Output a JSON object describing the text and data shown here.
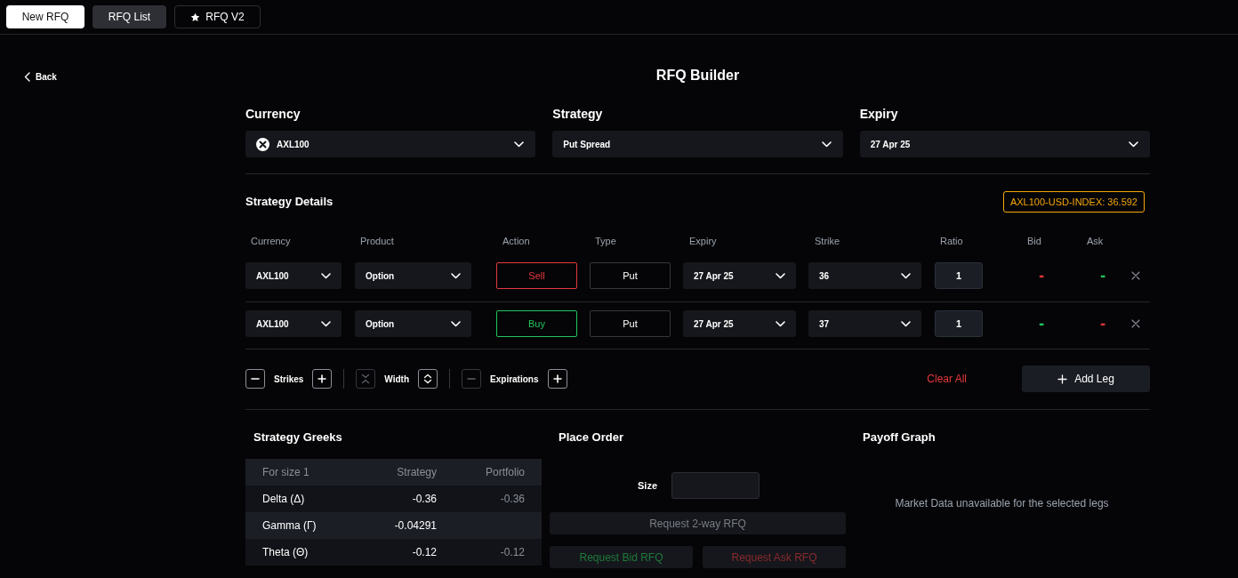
{
  "tabs": [
    {
      "label": "New RFQ",
      "kind": "primary"
    },
    {
      "label": "RFQ List",
      "kind": "secondary"
    },
    {
      "label": "RFQ V2",
      "kind": "starred"
    }
  ],
  "back": {
    "label": "Back"
  },
  "title": "RFQ Builder",
  "selectors": [
    {
      "label": "Currency",
      "value": "AXL100",
      "kind": "coin"
    },
    {
      "label": "Strategy",
      "value": "Put Spread",
      "kind": "plain"
    },
    {
      "label": "Expiry",
      "value": "27 Apr 25",
      "kind": "plain"
    }
  ],
  "strategy_details": {
    "title": "Strategy Details",
    "index_badge": "AXL100-USD-INDEX: 36.592",
    "columns": [
      "Currency",
      "Product",
      "Action",
      "Type",
      "Expiry",
      "Strike",
      "Ratio",
      "Bid",
      "Ask"
    ],
    "legs": [
      {
        "currency": "AXL100",
        "product": "Option",
        "action": "Sell",
        "kind": "sell",
        "type": "Put",
        "expiry": "27 Apr 25",
        "strike": "36",
        "ratio": "1",
        "bid": {
          "text": "-",
          "color": "#e5383b"
        },
        "ask": {
          "text": "-",
          "color": "#22c55e"
        }
      },
      {
        "currency": "AXL100",
        "product": "Option",
        "action": "Buy",
        "kind": "buy",
        "type": "Put",
        "expiry": "27 Apr 25",
        "strike": "37",
        "ratio": "1",
        "bid": {
          "text": "-",
          "color": "#22c55e"
        },
        "ask": {
          "text": "-",
          "color": "#e5383b"
        }
      }
    ]
  },
  "controls": {
    "adjusters": [
      {
        "label": "Strikes",
        "kind": "count",
        "decrease_disabled": false,
        "increase_disabled": false
      },
      {
        "label": "Width",
        "kind": "width",
        "decrease_disabled": true,
        "increase_disabled": false
      },
      {
        "label": "Expirations",
        "kind": "count",
        "decrease_disabled": true,
        "increase_disabled": false
      }
    ],
    "clear_all": "Clear All",
    "add_leg": "Add Leg"
  },
  "greeks": {
    "title": "Strategy Greeks",
    "columns": [
      "For size 1",
      "Strategy",
      "Portfolio"
    ],
    "rows": [
      {
        "name": "Delta (Δ)",
        "strategy": "-0.36",
        "portfolio": "-0.36"
      },
      {
        "name": "Gamma (Γ)",
        "strategy": "-0.04291"
      },
      {
        "name": "Theta (Θ)",
        "strategy": "-0.12",
        "portfolio": "-0.12"
      }
    ]
  },
  "place_order": {
    "title": "Place Order",
    "size_label": "Size",
    "buttons": [
      {
        "label": "Request 2-way RFQ",
        "kind": "two_way",
        "disabled": true
      },
      {
        "label": "Request Bid RFQ",
        "kind": "bid",
        "disabled": true
      },
      {
        "label": "Request Ask RFQ",
        "kind": "ask",
        "disabled": true
      }
    ]
  },
  "payoff_graph": {
    "title": "Payoff Graph",
    "message": "Market Data unavailable for the selected legs"
  }
}
